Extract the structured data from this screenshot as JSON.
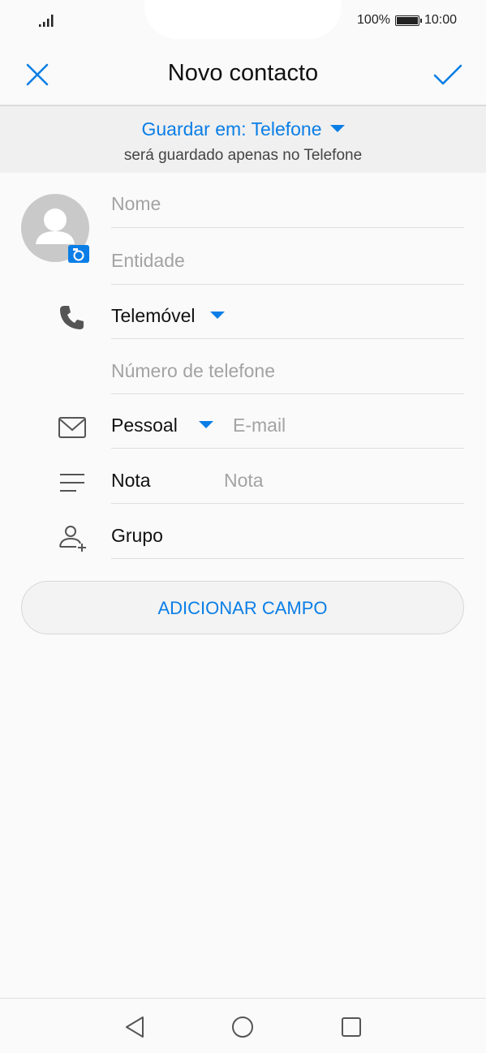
{
  "status_bar": {
    "battery_percent": "100%",
    "time": "10:00"
  },
  "header": {
    "title": "Novo contacto",
    "close_icon": "close-icon",
    "confirm_icon": "checkmark-icon"
  },
  "save_location": {
    "label": "Guardar em: Telefone",
    "note": "será guardado apenas no Telefone"
  },
  "form": {
    "name_placeholder": "Nome",
    "company_placeholder": "Entidade",
    "phone_type": "Telemóvel",
    "phone_placeholder": "Número de telefone",
    "email_type": "Pessoal",
    "email_placeholder": "E-mail",
    "note_label": "Nota",
    "note_placeholder": "Nota",
    "group_label": "Grupo"
  },
  "add_field_label": "ADICIONAR CAMPO",
  "colors": {
    "accent": "#0a7ee6",
    "background": "#fafafa",
    "banner": "#f0f0f0"
  },
  "icons": [
    "signal-icon",
    "battery-icon",
    "close-icon",
    "checkmark-icon",
    "avatar-icon",
    "camera-icon",
    "phone-icon",
    "mail-icon",
    "note-icon",
    "group-add-icon",
    "back-icon",
    "home-icon",
    "recents-icon"
  ]
}
